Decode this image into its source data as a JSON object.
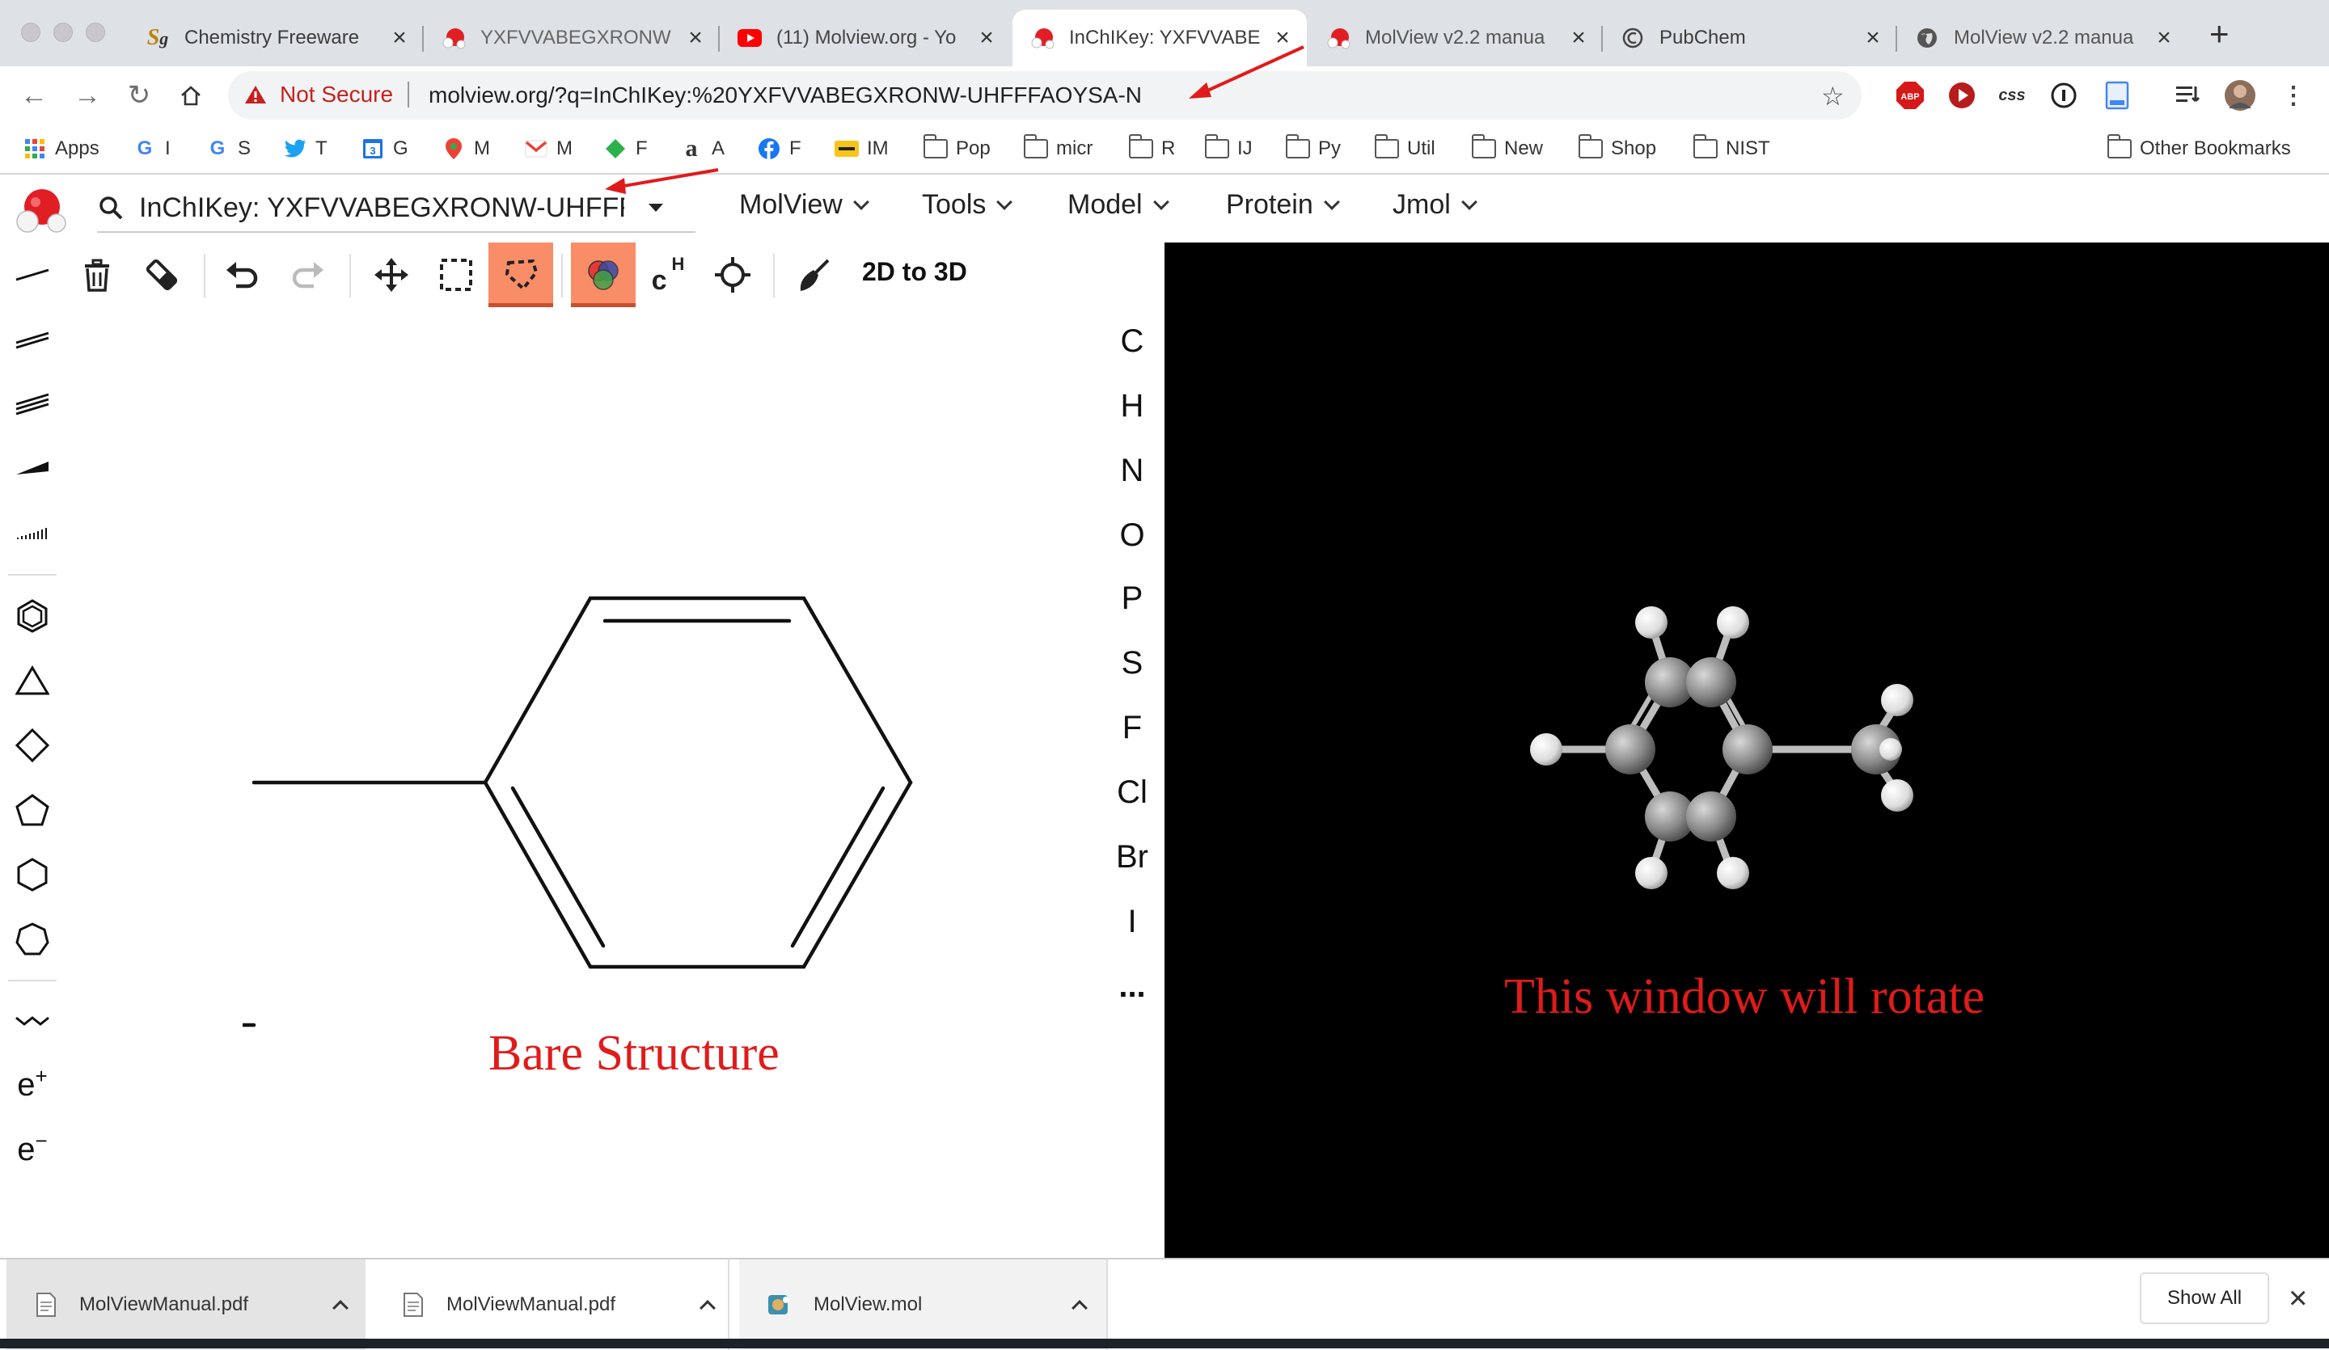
{
  "browser": {
    "tabs": [
      {
        "title": "Chemistry Freeware",
        "icon": "sg-logo-icon"
      },
      {
        "title": "YXFVVABEGXRONW",
        "icon": "molview-icon"
      },
      {
        "title": "(11) Molview.org - Yo",
        "icon": "youtube-icon"
      },
      {
        "title": "InChIKey: YXFVVABE",
        "icon": "molview-icon",
        "active": true
      },
      {
        "title": "MolView v2.2 manua",
        "icon": "molview-icon"
      },
      {
        "title": "PubChem",
        "icon": "pubchem-icon"
      },
      {
        "title": "MolView v2.2 manua",
        "icon": "globe-icon"
      }
    ],
    "new_tab": "+",
    "security": "Not Secure",
    "url": "molview.org/?q=InChIKey:%20YXFVVABEGXRONW-UHFFFAOYSA-N",
    "extensions": [
      "ABP",
      "css"
    ],
    "bookmarks": [
      {
        "label": "Apps",
        "icon": "apps-grid-icon"
      },
      {
        "label": "I",
        "icon": "google-icon"
      },
      {
        "label": "S",
        "icon": "google-icon"
      },
      {
        "label": "T",
        "icon": "twitter-icon"
      },
      {
        "label": "G",
        "icon": "calendar-icon"
      },
      {
        "label": "M",
        "icon": "maps-icon"
      },
      {
        "label": "M",
        "icon": "gmail-icon"
      },
      {
        "label": "F",
        "icon": "feedly-icon"
      },
      {
        "label": "A",
        "icon": "amazon-icon"
      },
      {
        "label": "F",
        "icon": "facebook-icon"
      },
      {
        "label": "IM",
        "icon": "imdb-icon"
      },
      {
        "label": "Pop",
        "icon": "folder-icon"
      },
      {
        "label": "micr",
        "icon": "folder-icon"
      },
      {
        "label": "R",
        "icon": "folder-icon"
      },
      {
        "label": "IJ",
        "icon": "folder-icon"
      },
      {
        "label": "Py",
        "icon": "folder-icon"
      },
      {
        "label": "Util",
        "icon": "folder-icon"
      },
      {
        "label": "New",
        "icon": "folder-icon"
      },
      {
        "label": "Shop",
        "icon": "folder-icon"
      },
      {
        "label": "NIST",
        "icon": "folder-icon"
      }
    ],
    "other_bookmarks": "Other Bookmarks"
  },
  "molview": {
    "search_value": "InChIKey: YXFVVABEGXRONW-UHFFFAOY",
    "menus": [
      "MolView",
      "Tools",
      "Model",
      "Protein",
      "Jmol"
    ],
    "toolbar": {
      "two_d_to_three_d": "2D to 3D",
      "hydrogen_toggle": "c",
      "hydrogen_sup": "H"
    },
    "elements": [
      "C",
      "H",
      "N",
      "O",
      "P",
      "S",
      "F",
      "Cl",
      "Br",
      "I",
      "..."
    ],
    "charges": {
      "plus_base": "e",
      "plus_sup": "+",
      "minus_base": "e",
      "minus_sup": "−"
    },
    "sketch_caption": "Bare Structure",
    "viewer_caption": "This window will rotate",
    "caption_color": "#e01b1b",
    "active_tool_color": "#f88d68"
  },
  "downloads": {
    "items": [
      "MolViewManual.pdf",
      "MolViewManual.pdf",
      "MolView.mol"
    ],
    "show_all": "Show All"
  }
}
